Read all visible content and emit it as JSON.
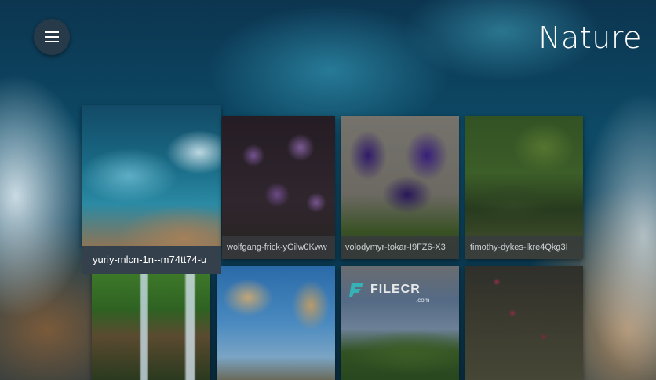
{
  "app": {
    "title": "Nature",
    "menu_icon": "hamburger-menu-icon"
  },
  "hover_tooltip": "yuriy-mlcn-1n--m74tt74-u",
  "grid": {
    "tiles": [
      {
        "caption": "",
        "image": "ocean-waves-photo"
      },
      {
        "caption": "wolfgang-frick-yGilw0Kww",
        "image": "purple-flowers-photo"
      },
      {
        "caption": "volodymyr-tokar-I9FZ6-X3",
        "image": "purple-iris-photo"
      },
      {
        "caption": "timothy-dykes-lkre4Qkg3I",
        "image": "green-lake-forest-photo"
      },
      {
        "caption": "",
        "image": "forest-waterfall-photo"
      },
      {
        "caption": "",
        "image": "joshua-tree-photo"
      },
      {
        "caption": "",
        "image": "green-hill-sky-photo"
      },
      {
        "caption": "",
        "image": "pink-flower-stem-photo"
      }
    ]
  },
  "watermark": {
    "text": "FILECR",
    "sub": ".com"
  }
}
